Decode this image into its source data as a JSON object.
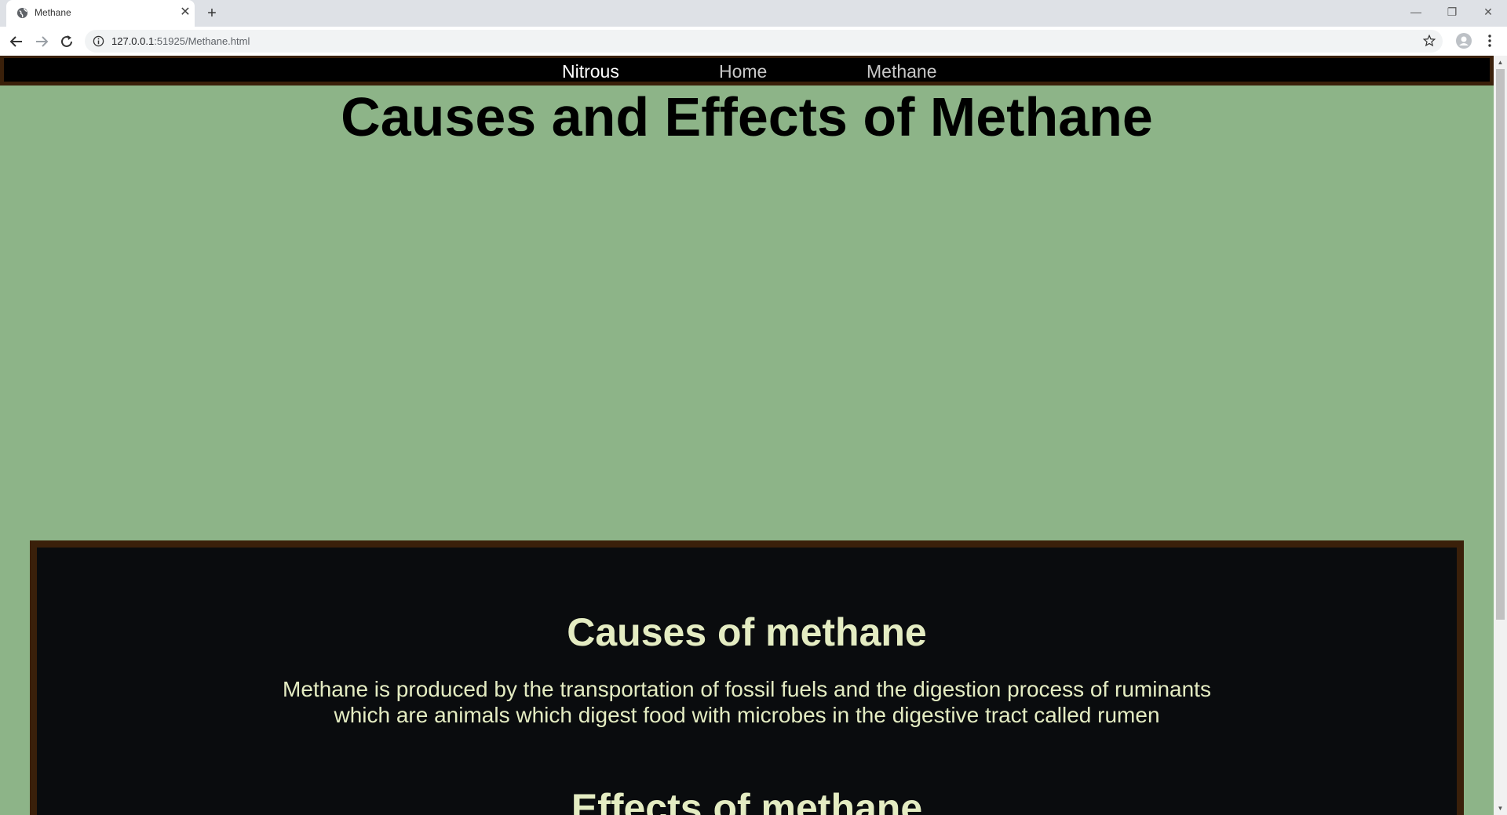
{
  "browser": {
    "tab_title": "Methane",
    "new_tab_symbol": "+",
    "url_host": "127.0.0.1",
    "url_rest": ":51925/Methane.html"
  },
  "nav": {
    "items": [
      "Nitrous",
      "Home",
      "Methane"
    ],
    "active": "Nitrous"
  },
  "page": {
    "title": "Causes and Effects of Methane"
  },
  "content": {
    "causes_heading": "Causes of methane",
    "causes_line1": "Methane is produced by the transportation of fossil fuels and the digestion process of ruminants",
    "causes_line2": "which are animals which digest food with microbes in the digestive tract called rumen",
    "effects_heading": "Effects of methane"
  },
  "colors": {
    "page_background": "#8db488",
    "nav_background": "#000000",
    "border_brown": "#3a200a",
    "content_background": "#0a0c0e",
    "content_text": "#e4ecc2"
  },
  "icons": [
    "globe-icon",
    "close-icon",
    "plus-icon",
    "back-arrow-icon",
    "forward-arrow-icon",
    "reload-icon",
    "info-icon",
    "star-icon",
    "profile-icon",
    "menu-dots-icon",
    "minimize-icon",
    "restore-icon",
    "window-close-icon"
  ]
}
